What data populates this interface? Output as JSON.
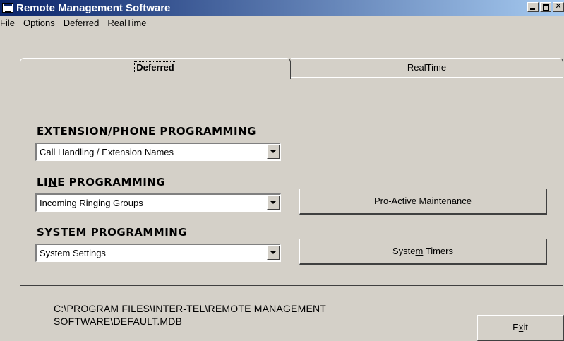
{
  "window": {
    "title": "Remote Management Software"
  },
  "menu": {
    "items": [
      "File",
      "Options",
      "Deferred",
      "RealTime"
    ]
  },
  "tabs": {
    "deferred": "Deferred",
    "realtime": "RealTime"
  },
  "extension": {
    "label_mnemonic": "E",
    "label_rest": "XTENSION/PHONE  PROGRAMMING",
    "selected": "Call Handling / Extension Names"
  },
  "line": {
    "label_a": "LI",
    "label_mnemonic": "N",
    "label_b": "E PROGRAMMING",
    "selected": "Incoming Ringing Groups"
  },
  "system": {
    "label_mnemonic": "S",
    "label_rest": "YSTEM PROGRAMMING",
    "selected": "System Settings"
  },
  "buttons": {
    "proactive_a": "Pr",
    "proactive_mnemonic": "o",
    "proactive_b": "-Active Maintenance",
    "timers_a": "Syste",
    "timers_mnemonic": "m",
    "timers_b": " Timers",
    "exit_a": "E",
    "exit_mnemonic": "x",
    "exit_b": "it"
  },
  "status": {
    "path_line1": "C:\\PROGRAM FILES\\INTER-TEL\\REMOTE MANAGEMENT",
    "path_line2": "SOFTWARE\\DEFAULT.MDB"
  }
}
